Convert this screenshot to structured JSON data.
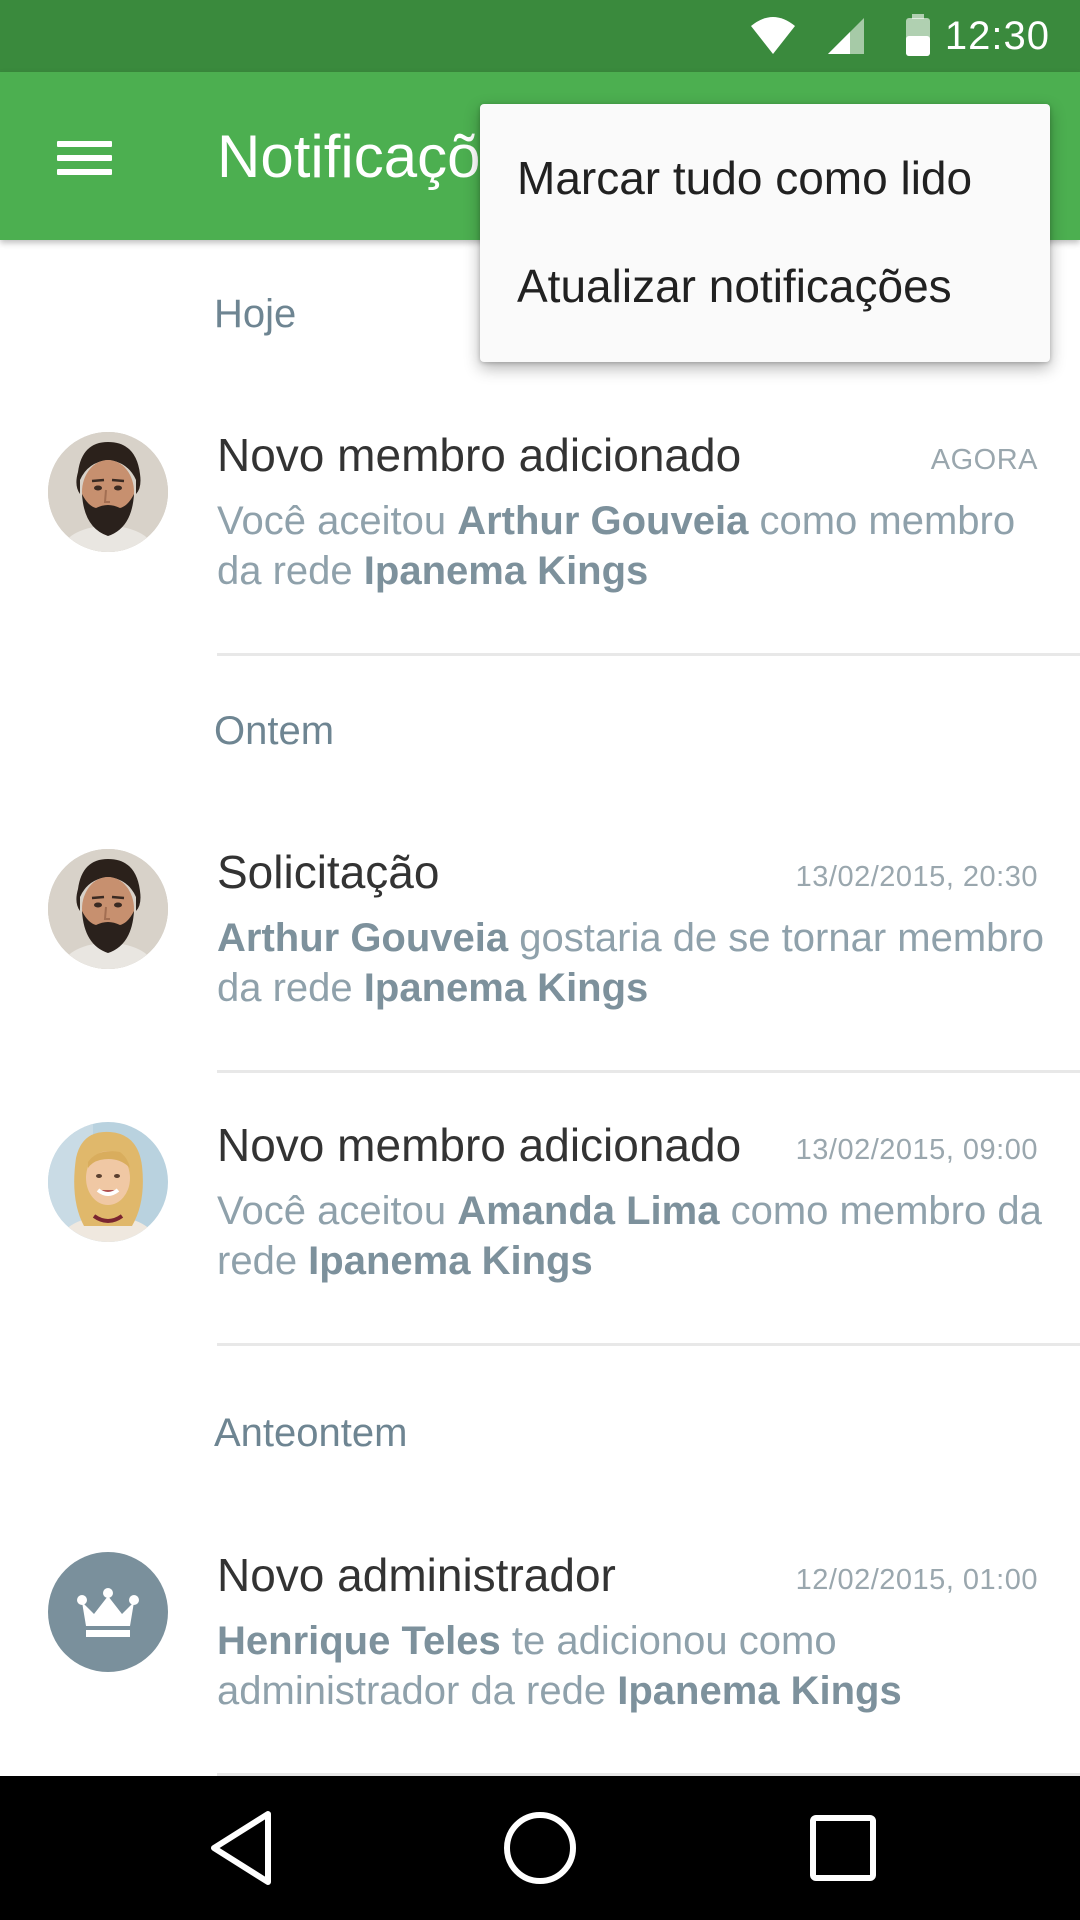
{
  "status_bar": {
    "time": "12:30",
    "icons": [
      "wifi-icon",
      "cell-signal-icon",
      "battery-icon"
    ]
  },
  "app_bar": {
    "title": "Notificações",
    "menu_icon": "hamburger-menu-icon",
    "background_color": "#4caf50"
  },
  "overflow_menu": {
    "items": [
      {
        "label": "Marcar tudo como lido"
      },
      {
        "label": "Atualizar notificações"
      }
    ]
  },
  "sections": [
    {
      "header": "Hoje",
      "notifications": [
        {
          "avatar": "man-bearded-photo",
          "title": "Novo membro adicionado",
          "timestamp": "AGORA",
          "body": [
            {
              "text": "Você aceitou "
            },
            {
              "text": "Arthur Gouveia",
              "bold": true
            },
            {
              "text": " como membro da rede "
            },
            {
              "text": "Ipanema Kings",
              "bold": true
            }
          ]
        }
      ]
    },
    {
      "header": "Ontem",
      "notifications": [
        {
          "avatar": "man-bearded-photo",
          "title": "Solicitação",
          "timestamp": "13/02/2015, 20:30",
          "body": [
            {
              "text": "Arthur Gouveia",
              "bold": true
            },
            {
              "text": " gostaria de se tornar membro da rede "
            },
            {
              "text": "Ipanema Kings",
              "bold": true
            }
          ]
        },
        {
          "avatar": "woman-blonde-photo",
          "title": "Novo membro adicionado",
          "timestamp": "13/02/2015, 09:00",
          "body": [
            {
              "text": "Você aceitou "
            },
            {
              "text": "Amanda Lima",
              "bold": true
            },
            {
              "text": " como membro da rede "
            },
            {
              "text": "Ipanema Kings",
              "bold": true
            }
          ]
        }
      ]
    },
    {
      "header": "Anteontem",
      "notifications": [
        {
          "avatar": "crown-icon",
          "title": "Novo administrador",
          "timestamp": "12/02/2015, 01:00",
          "body": [
            {
              "text": "Henrique Teles",
              "bold": true
            },
            {
              "text": " te adicionou como administrador da rede "
            },
            {
              "text": "Ipanema Kings",
              "bold": true
            }
          ]
        }
      ]
    }
  ],
  "nav_bar": {
    "buttons": [
      "back-icon",
      "home-icon",
      "recent-apps-icon"
    ]
  },
  "colors": {
    "status_bar": "#3a8a3d",
    "app_bar": "#4caf50",
    "section_header": "#6e8592",
    "body_text": "#8fa1ab",
    "crown_avatar_bg": "#7a909c"
  }
}
